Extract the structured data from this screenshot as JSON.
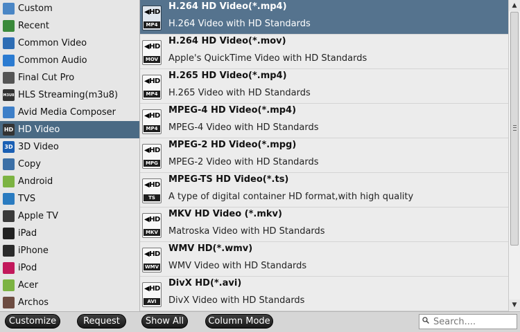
{
  "sidebar": {
    "items": [
      {
        "label": "Custom",
        "icon": "folder-icon",
        "badge": "",
        "color": "#4a86c5"
      },
      {
        "label": "Recent",
        "icon": "calendar-icon",
        "badge": "",
        "color": "#3b8a3b"
      },
      {
        "label": "Common Video",
        "icon": "film-icon",
        "badge": "",
        "color": "#2e6db4"
      },
      {
        "label": "Common Audio",
        "icon": "music-note-icon",
        "badge": "",
        "color": "#2b7bd1"
      },
      {
        "label": "Final Cut Pro",
        "icon": "clapperboard-icon",
        "badge": "",
        "color": "#555555"
      },
      {
        "label": "HLS Streaming(m3u8)",
        "icon": "m3u8-icon",
        "badge": "M3U8",
        "color": "#333333"
      },
      {
        "label": "Avid Media Composer",
        "icon": "avid-icon",
        "badge": "",
        "color": "#3e7fc8"
      },
      {
        "label": "HD Video",
        "icon": "hd-icon",
        "badge": "HD",
        "color": "#333333"
      },
      {
        "label": "3D Video",
        "icon": "3d-icon",
        "badge": "3D",
        "color": "#1a5fb4"
      },
      {
        "label": "Copy",
        "icon": "copy-icon",
        "badge": "",
        "color": "#3b6fa6"
      },
      {
        "label": "Android",
        "icon": "android-icon",
        "badge": "",
        "color": "#7cb342"
      },
      {
        "label": "TVS",
        "icon": "tv-icon",
        "badge": "",
        "color": "#2a7bc0"
      },
      {
        "label": "Apple TV",
        "icon": "apple-tv-icon",
        "badge": "",
        "color": "#3a3a3a"
      },
      {
        "label": "iPad",
        "icon": "ipad-icon",
        "badge": "",
        "color": "#222222"
      },
      {
        "label": "iPhone",
        "icon": "iphone-icon",
        "badge": "",
        "color": "#2b2b2b"
      },
      {
        "label": "iPod",
        "icon": "ipod-icon",
        "badge": "",
        "color": "#c2185b"
      },
      {
        "label": "Acer",
        "icon": "acer-icon",
        "badge": "",
        "color": "#7cb342"
      },
      {
        "label": "Archos",
        "icon": "archos-icon",
        "badge": "",
        "color": "#6d4c41"
      }
    ],
    "selected_index": 7
  },
  "formats": [
    {
      "title": "H.264 HD Video(*.mp4)",
      "desc": "H.264 Video with HD Standards",
      "ext": "MP4",
      "icon": "hd-mp4-icon"
    },
    {
      "title": "H.264 HD Video(*.mov)",
      "desc": "Apple's QuickTime Video with HD Standards",
      "ext": "MOV",
      "icon": "hd-mov-icon"
    },
    {
      "title": "H.265 HD Video(*.mp4)",
      "desc": "H.265 Video with HD Standards",
      "ext": "MP4",
      "icon": "h265-mp4-icon"
    },
    {
      "title": "MPEG-4 HD Video(*.mp4)",
      "desc": "MPEG-4 Video with HD Standards",
      "ext": "MP4",
      "icon": "hd-mp4-icon"
    },
    {
      "title": "MPEG-2 HD Video(*.mpg)",
      "desc": "MPEG-2 Video with HD Standards",
      "ext": "MPG",
      "icon": "hd-mpg-icon"
    },
    {
      "title": "MPEG-TS HD Video(*.ts)",
      "desc": "A type of digital container HD format,with high quality",
      "ext": "TS",
      "icon": "hd-ts-icon"
    },
    {
      "title": "MKV HD Video (*.mkv)",
      "desc": "Matroska Video with HD Standards",
      "ext": "MKV",
      "icon": "hd-mkv-icon"
    },
    {
      "title": "WMV HD(*.wmv)",
      "desc": "WMV Video with HD Standards",
      "ext": "WMV",
      "icon": "hd-wmv-icon"
    },
    {
      "title": "DivX HD(*.avi)",
      "desc": "DivX Video with HD Standards",
      "ext": "AVI",
      "icon": "hd-avi-icon"
    }
  ],
  "selected_format_index": 0,
  "bottombar": {
    "customize_label": "Customize",
    "request_label": "Request",
    "show_all_label": "Show All",
    "column_mode_label": "Column Mode",
    "search_placeholder": "Search...."
  }
}
